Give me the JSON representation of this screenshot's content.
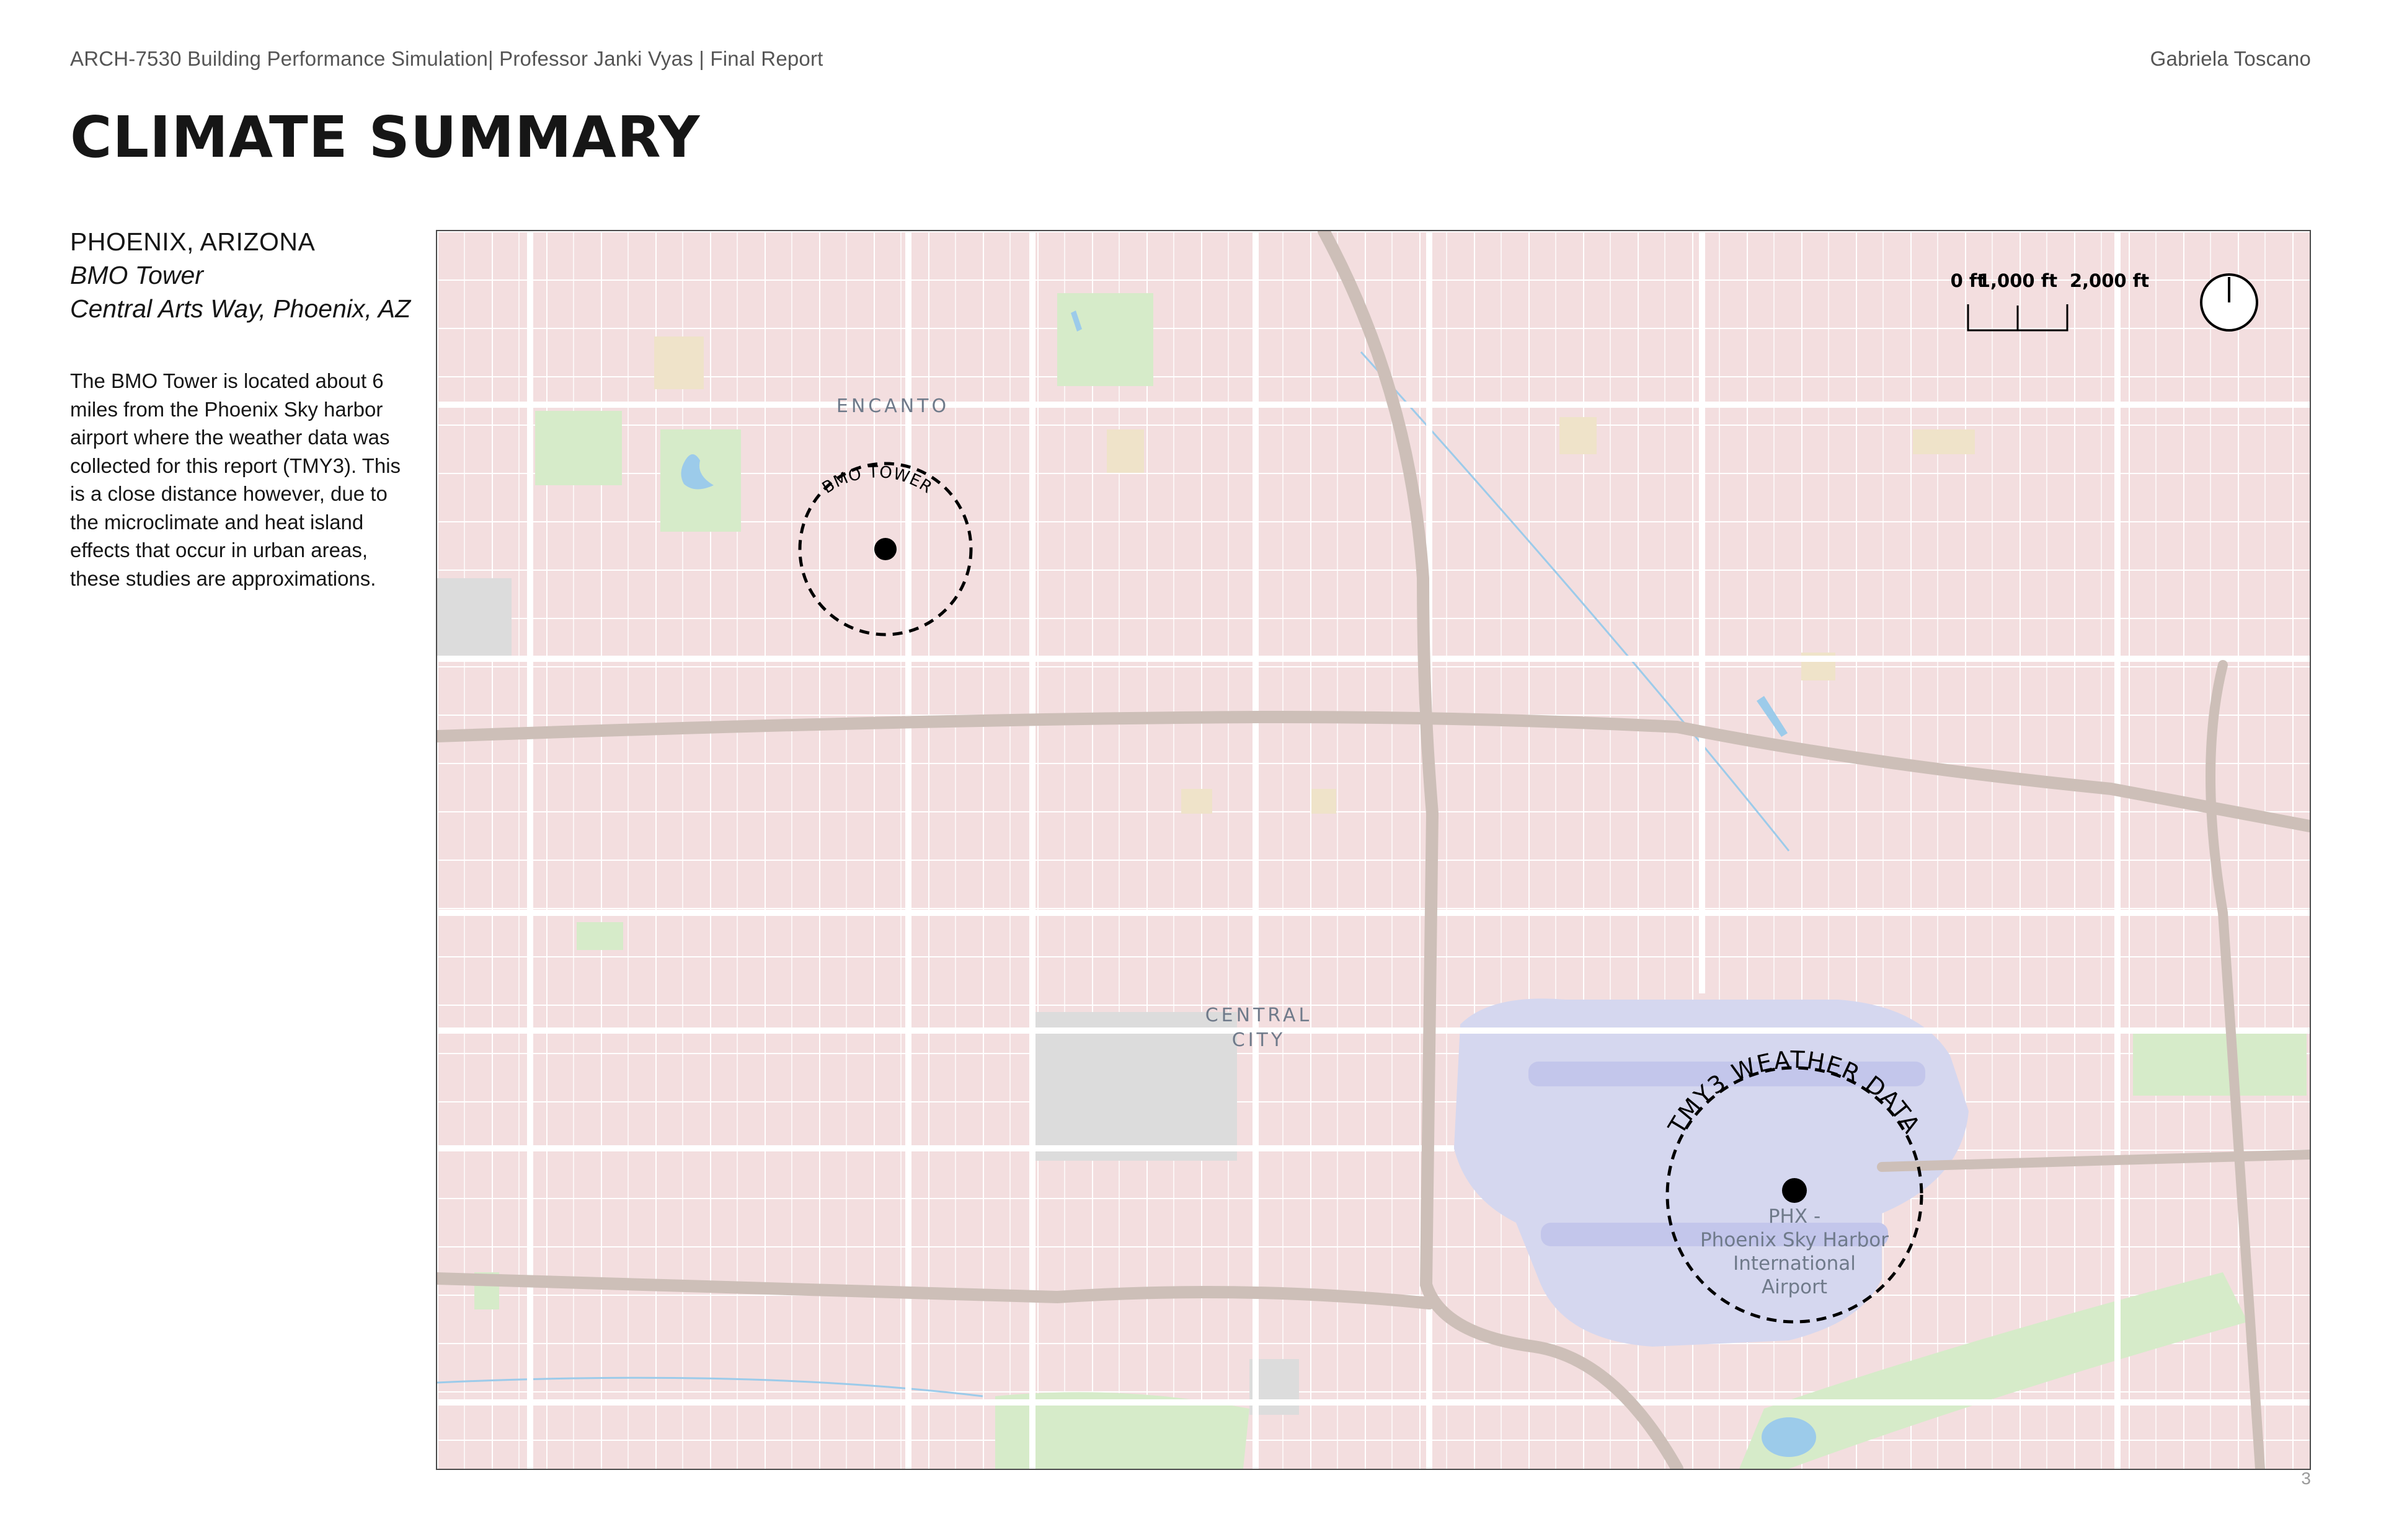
{
  "header": {
    "left": "ARCH-7530 Building Performance Simulation| Professor Janki Vyas | Final Report",
    "right": "Gabriela Toscano"
  },
  "title": "CLIMATE SUMMARY",
  "location": {
    "city": "PHOENIX, ARIZONA",
    "building": "BMO Tower",
    "address": "Central Arts Way, Phoenix, AZ"
  },
  "description": "The BMO Tower is located about 6 miles from the Phoenix Sky harbor airport where the weather data was collected for this report (TMY3). This is a close distance however, due to the microclimate and heat island effects that occur in urban areas, these studies are approximations.",
  "map": {
    "neighborhoods": [
      "ENCANTO",
      "CENTRAL",
      "CITY"
    ],
    "markers": {
      "bmo": "BMO TOWER",
      "tmy3": "TMY3 WEATHER DATA"
    },
    "airport_label": [
      "PHX -",
      "Phoenix Sky Harbor",
      "International",
      "Airport"
    ],
    "scale": {
      "labels": [
        "0 ft",
        "1,000 ft",
        "2,000 ft"
      ]
    },
    "colors": {
      "land": "#f3dedf",
      "street": "#ffffff",
      "freeway": "#cdbfb8",
      "park": "#d6ebc9",
      "water": "#9ccbea",
      "airport": "#d5d7ef",
      "label": "#6f7a8a",
      "marker": "#000000"
    },
    "icons": [
      "north-arrow-icon"
    ]
  },
  "page_number": "3"
}
